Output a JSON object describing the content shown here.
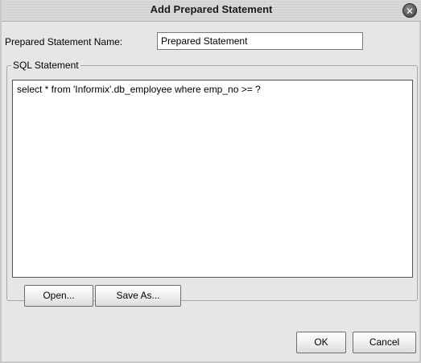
{
  "dialog": {
    "title": "Add Prepared Statement",
    "close_glyph": "✕"
  },
  "name_field": {
    "label": "Prepared Statement Name:",
    "value": "Prepared Statement"
  },
  "sql_group": {
    "legend": "SQL Statement",
    "statement": "select * from 'Informix'.db_employee where emp_no >= ?"
  },
  "buttons": {
    "open": "Open...",
    "save_as": "Save As...",
    "ok": "OK",
    "cancel": "Cancel"
  },
  "icons": {
    "close": "close-icon"
  }
}
